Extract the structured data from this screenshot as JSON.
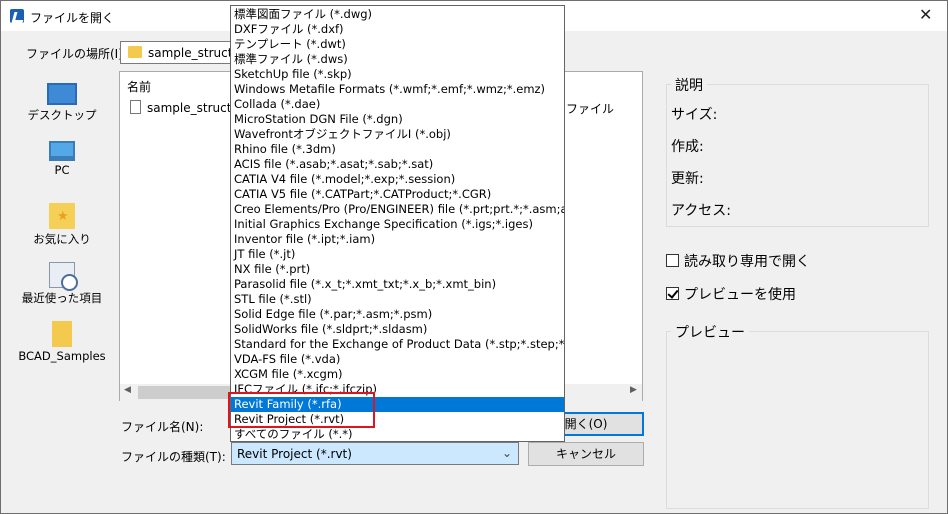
{
  "dialog": {
    "title": "ファイルを開く",
    "close_glyph": "✕"
  },
  "location": {
    "label": "ファイルの場所(I):",
    "value": "sample_structure"
  },
  "places": [
    {
      "label": "デスクトップ",
      "icon": "desktop-icon"
    },
    {
      "label": "PC",
      "icon": "pc-icon"
    },
    {
      "label": "お気に入り",
      "icon": "favorites-icon"
    },
    {
      "label": "最近使った項目",
      "icon": "recent-items-icon"
    },
    {
      "label": "BCAD_Samples",
      "icon": "folder-icon"
    }
  ],
  "file_list": {
    "column_name": "名前",
    "items": [
      {
        "name": "sample_structure",
        "type": "ファイル"
      }
    ],
    "scroll_left_glyph": "◀",
    "scroll_right_glyph": "▶"
  },
  "filename_label": "ファイル名(N):",
  "filetype_label": "ファイルの種類(T):",
  "filetype_value": "Revit Project (*.rvt)",
  "open_button": "開く(O)",
  "cancel_button": "キャンセル",
  "description": {
    "legend": "説明",
    "size_label": "サイズ:",
    "created_label": "作成:",
    "modified_label": "更新:",
    "accessed_label": "アクセス:"
  },
  "readonly_checkbox": {
    "label": "読み取り専用で開く",
    "checked": false
  },
  "preview_checkbox": {
    "label": "プレビューを使用",
    "checked": true
  },
  "preview_legend": "プレビュー",
  "dropdown_items": [
    "標準図面ファイル (*.dwg)",
    "DXFファイル (*.dxf)",
    "テンプレート (*.dwt)",
    "標準ファイル (*.dws)",
    "SketchUp file (*.skp)",
    "Windows Metafile Formats (*.wmf;*.emf;*.wmz;*.emz)",
    "Collada (*.dae)",
    "MicroStation DGN File (*.dgn)",
    "WavefrontオブジェクトファイルI (*.obj)",
    "Rhino file (*.3dm)",
    "ACIS file (*.asab;*.asat;*.sab;*.sat)",
    "CATIA V4 file (*.model;*.exp;*.session)",
    "CATIA V5 file (*.CATPart;*.CATProduct;*.CGR)",
    "Creo Elements/Pro (Pro/ENGINEER) file (*.prt;prt.*;*.asm;asm.*)",
    "Initial Graphics Exchange Specification (*.igs;*.iges)",
    "Inventor file (*.ipt;*.iam)",
    "JT file (*.jt)",
    "NX file (*.prt)",
    "Parasolid file (*.x_t;*.xmt_txt;*.x_b;*.xmt_bin)",
    "STL file (*.stl)",
    "Solid Edge file (*.par;*.asm;*.psm)",
    "SolidWorks file (*.sldprt;*.sldasm)",
    "Standard for the Exchange of Product Data (*.stp;*.step;*.stpz)",
    "VDA-FS file (*.vda)",
    "XCGM file (*.xcgm)",
    "IFCファイル (*.ifc;*.ifczip)",
    "Revit Family (*.rfa)",
    "Revit Project (*.rvt)",
    "すべてのファイル (*.*)"
  ],
  "dropdown_selected_index": 26,
  "highlight_color": "#0078d7",
  "annotation_color": "#e0141e"
}
